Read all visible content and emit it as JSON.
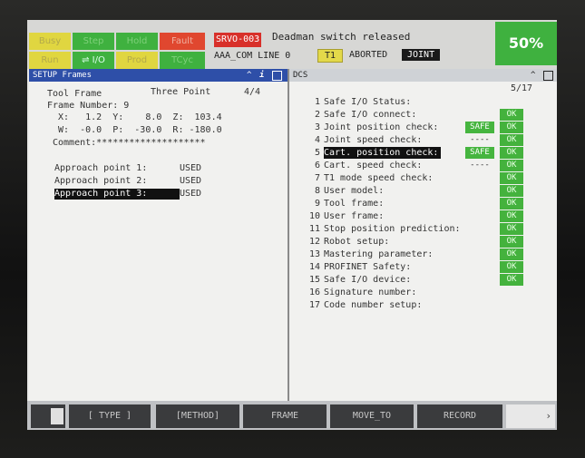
{
  "status": {
    "indicators": [
      {
        "label": "Busy",
        "color": "yellow"
      },
      {
        "label": "Step",
        "color": "green"
      },
      {
        "label": "Hold",
        "color": "green"
      },
      {
        "label": "Fault",
        "color": "red"
      },
      {
        "label": "Run",
        "color": "yellow"
      },
      {
        "label": "I/O",
        "color": "green"
      },
      {
        "label": "Prod",
        "color": "yellow"
      },
      {
        "label": "TCyc",
        "color": "green"
      }
    ],
    "alarm_code": "SRVO-003",
    "alarm_message": "Deadman switch released",
    "program_line": "AAA_COM LINE 0",
    "mode": "T1",
    "state": "ABORTED",
    "jog_frame": "JOINT",
    "override": "50%"
  },
  "left_pane": {
    "title": "SETUP Frames",
    "heading_left": "Tool Frame",
    "heading_method": "Three Point",
    "page": "4/4",
    "frame_number": "Frame Number: 9",
    "xyz": "X:   1.2  Y:    8.0  Z:  103.4",
    "wpr": "W:  -0.0  P:  -30.0  R: -180.0",
    "comment": "Comment:********************",
    "approach": [
      {
        "label": "Approach point 1:",
        "value": "USED"
      },
      {
        "label": "Approach point 2:",
        "value": "USED"
      },
      {
        "label": "Approach point 3:",
        "value": "USED"
      }
    ]
  },
  "right_pane": {
    "title": "DCS",
    "page": "5/17",
    "rows": [
      {
        "num": "1",
        "label": "Safe I/O Status:",
        "status": "",
        "result": ""
      },
      {
        "num": "2",
        "label": "Safe I/O connect:",
        "status": "",
        "result": "OK"
      },
      {
        "num": "3",
        "label": "Joint position check:",
        "status": "SAFE",
        "result": "OK"
      },
      {
        "num": "4",
        "label": "Joint speed check:",
        "status": "----",
        "result": "OK"
      },
      {
        "num": "5",
        "label": "Cart. position check:",
        "status": "SAFE",
        "result": "OK"
      },
      {
        "num": "6",
        "label": "Cart. speed check:",
        "status": "----",
        "result": "OK"
      },
      {
        "num": "7",
        "label": "T1 mode speed check:",
        "status": "",
        "result": "OK"
      },
      {
        "num": "8",
        "label": "User model:",
        "status": "",
        "result": "OK"
      },
      {
        "num": "9",
        "label": "Tool frame:",
        "status": "",
        "result": "OK"
      },
      {
        "num": "10",
        "label": "User frame:",
        "status": "",
        "result": "OK"
      },
      {
        "num": "11",
        "label": "Stop position prediction:",
        "status": "",
        "result": "OK"
      },
      {
        "num": "12",
        "label": "Robot setup:",
        "status": "",
        "result": "OK"
      },
      {
        "num": "13",
        "label": "Mastering parameter:",
        "status": "",
        "result": "OK"
      },
      {
        "num": "14",
        "label": "PROFINET Safety:",
        "status": "",
        "result": "OK"
      },
      {
        "num": "15",
        "label": "Safe I/O device:",
        "status": "",
        "result": "OK"
      },
      {
        "num": "16",
        "label": "Signature number:",
        "status": "",
        "result": ""
      },
      {
        "num": "17",
        "label": "Code number setup:",
        "status": "",
        "result": ""
      }
    ]
  },
  "function_keys": {
    "f1": "[ TYPE ]",
    "f2": "[METHOD]",
    "f3": "FRAME",
    "f4": "MOVE_TO",
    "f5": "RECORD",
    "next": "›"
  },
  "colors": {
    "title_blue": "#2e4fa8",
    "ok_green": "#44b23d",
    "alarm_red": "#d8302a",
    "mode_yellow": "#e3d94a"
  }
}
